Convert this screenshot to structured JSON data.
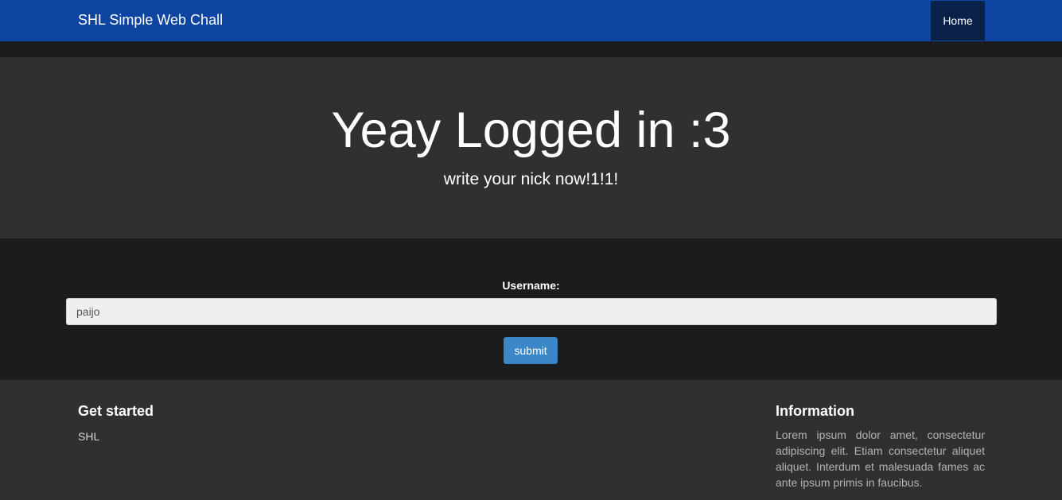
{
  "navbar": {
    "brand": "SHL Simple Web Chall",
    "home_label": "Home",
    "colors": {
      "background": "#0e45a1",
      "active_item": "#0a2149"
    }
  },
  "hero": {
    "title": "Yeay Logged in :3",
    "subtitle": "write your nick now!1!1!"
  },
  "form": {
    "username_label": "Username:",
    "username_value": "paijo",
    "submit_label": "submit",
    "colors": {
      "button": "#3c87c8"
    }
  },
  "footer": {
    "left": {
      "heading": "Get started",
      "text": "SHL"
    },
    "right": {
      "heading": "Information",
      "text": "Lorem ipsum dolor amet, consectetur adipiscing elit. Etiam consectetur aliquet aliquet. Interdum et malesuada fames ac ante ipsum primis in faucibus."
    }
  }
}
